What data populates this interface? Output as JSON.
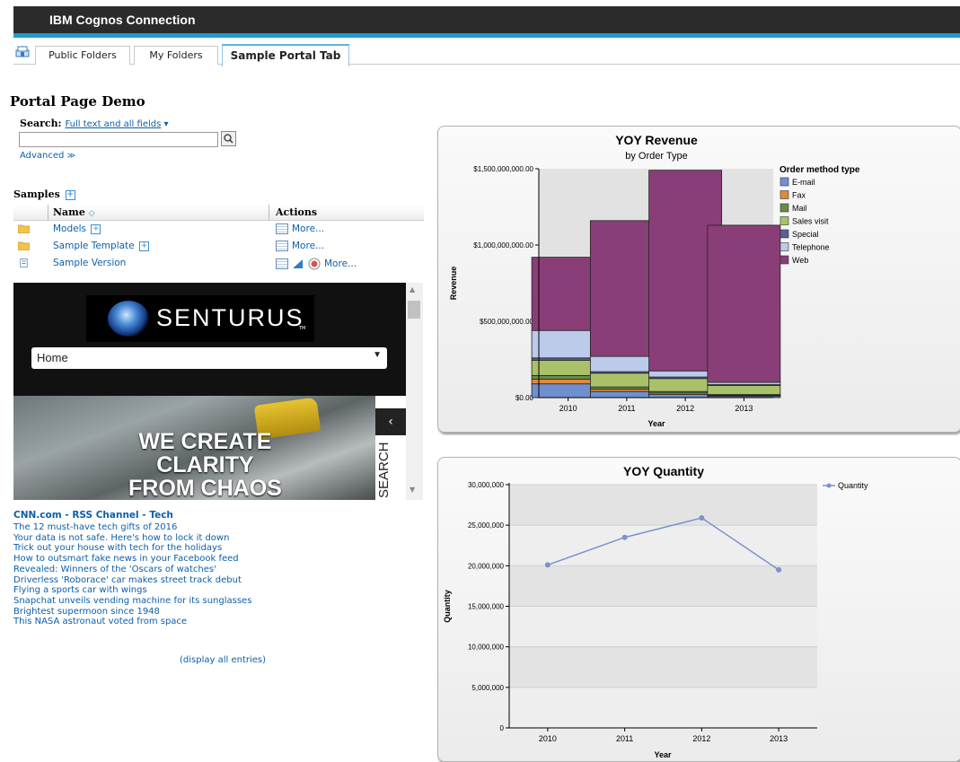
{
  "app": {
    "title": "IBM Cognos Connection"
  },
  "tabs": [
    {
      "label": "Public Folders"
    },
    {
      "label": "My Folders"
    },
    {
      "label": "Sample Portal Tab",
      "active": true
    }
  ],
  "page": {
    "title": "Portal Page Demo"
  },
  "search": {
    "label": "Search:",
    "scope": "Full text and all fields",
    "advanced": "Advanced",
    "value": ""
  },
  "samples": {
    "title": "Samples",
    "columns": [
      "Name",
      "Actions"
    ],
    "rows": [
      {
        "name": "Models",
        "icon": "folder-icon",
        "action": "More..."
      },
      {
        "name": "Sample Template",
        "icon": "folder-icon",
        "action": "More..."
      },
      {
        "name": "Sample Version",
        "icon": "report-icon",
        "action": "More..."
      }
    ]
  },
  "embedded": {
    "logo": "SENTURUS",
    "logo_tm": "TM",
    "nav_selected": "Home",
    "hero_lines": [
      "WE CREATE",
      "CLARITY",
      "FROM CHAOS"
    ],
    "side_tab": "SEARCH"
  },
  "rss": {
    "title": "CNN.com - RSS Channel - Tech",
    "items": [
      "The 12 must-have tech gifts of 2016",
      "Your data is not safe. Here's how to lock it down",
      "Trick out your house with tech for the holidays",
      "How to outsmart fake news in your Facebook feed",
      "Revealed: Winners of the 'Oscars of watches'",
      "Driverless 'Roborace' car makes street track debut",
      "Flying a sports car with wings",
      "Snapchat unveils vending machine for its sunglasses",
      "Brightest supermoon since 1948",
      "This NASA astronaut voted from space"
    ],
    "display_all": "(display all entries)"
  },
  "colors": {
    "accent": "#1d9bd1",
    "link": "#0b5fab",
    "topbar": "#2b2b2b"
  },
  "chart_data": [
    {
      "type": "bar",
      "stacked": true,
      "title": "YOY Revenue",
      "subtitle": "by Order Type",
      "xlabel": "Year",
      "ylabel": "Revenue",
      "categories": [
        "2010",
        "2011",
        "2012",
        "2013"
      ],
      "ylim": [
        0,
        1500000000
      ],
      "yticks": [
        0,
        500000000,
        1000000000,
        1500000000
      ],
      "ytick_labels": [
        "$0.00",
        "$500,000,000.00",
        "$1,000,000,000.00",
        "$1,500,000,000.00"
      ],
      "legend_title": "Order method type",
      "legend_position": "right",
      "series": [
        {
          "name": "E-mail",
          "color": "#6f8fcf",
          "values": [
            90000000,
            40000000,
            20000000,
            10000000
          ]
        },
        {
          "name": "Fax",
          "color": "#e08a3c",
          "values": [
            30000000,
            15000000,
            10000000,
            5000000
          ]
        },
        {
          "name": "Mail",
          "color": "#6a8b48",
          "values": [
            25000000,
            15000000,
            10000000,
            5000000
          ]
        },
        {
          "name": "Sales visit",
          "color": "#a9c26a",
          "values": [
            100000000,
            90000000,
            85000000,
            60000000
          ]
        },
        {
          "name": "Special",
          "color": "#5c5f8f",
          "values": [
            15000000,
            10000000,
            10000000,
            5000000
          ]
        },
        {
          "name": "Telephone",
          "color": "#bccbea",
          "values": [
            180000000,
            100000000,
            40000000,
            15000000
          ]
        },
        {
          "name": "Web",
          "color": "#8a3e78",
          "values": [
            480000000,
            890000000,
            1315000000,
            1030000000
          ]
        }
      ]
    },
    {
      "type": "line",
      "title": "YOY Quantity",
      "xlabel": "Year",
      "ylabel": "Quantity",
      "categories": [
        "2010",
        "2011",
        "2012",
        "2013"
      ],
      "ylim": [
        0,
        30000000
      ],
      "yticks": [
        0,
        5000000,
        10000000,
        15000000,
        20000000,
        25000000,
        30000000
      ],
      "ytick_labels": [
        "0",
        "5,000,000",
        "10,000,000",
        "15,000,000",
        "20,000,000",
        "25,000,000",
        "30,000,000"
      ],
      "legend_position": "top-right",
      "series": [
        {
          "name": "Quantity",
          "color": "#7b93cc",
          "values": [
            20100000,
            23500000,
            25900000,
            19500000
          ]
        }
      ]
    }
  ]
}
